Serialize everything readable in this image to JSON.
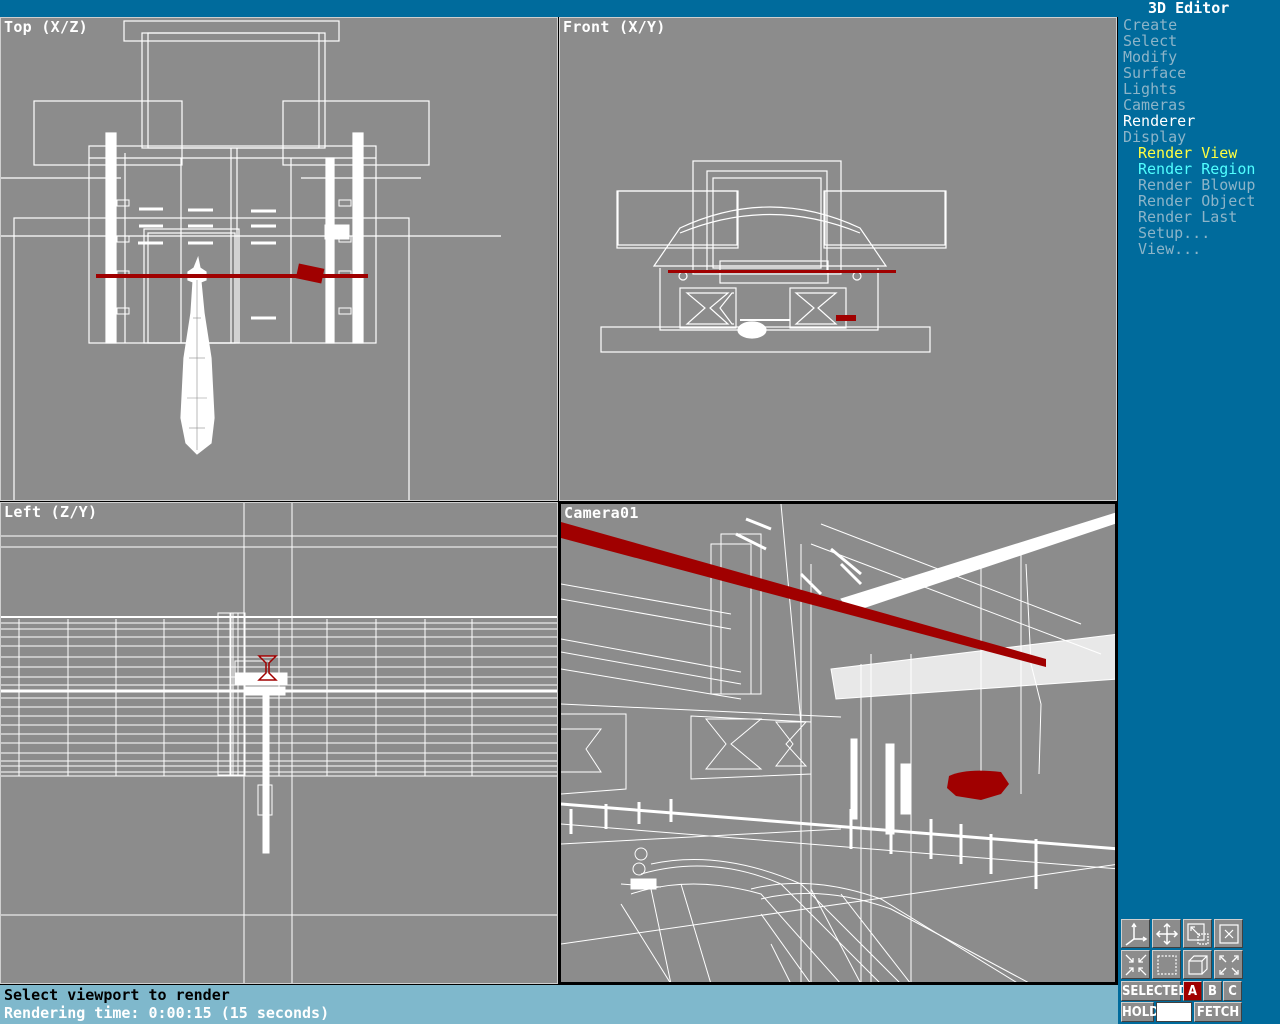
{
  "app": {
    "title": "3D Editor"
  },
  "menu": {
    "items": [
      {
        "label": "Create",
        "state": "normal"
      },
      {
        "label": "Select",
        "state": "normal"
      },
      {
        "label": "Modify",
        "state": "normal"
      },
      {
        "label": "Surface",
        "state": "normal"
      },
      {
        "label": "Lights",
        "state": "normal"
      },
      {
        "label": "Cameras",
        "state": "normal"
      },
      {
        "label": "Renderer",
        "state": "current"
      },
      {
        "label": "Display",
        "state": "normal"
      }
    ],
    "subitems": [
      {
        "label": "Render View",
        "state": "selected"
      },
      {
        "label": "Render Region",
        "state": "highlight"
      },
      {
        "label": "Render Blowup",
        "state": "normal"
      },
      {
        "label": "Render Object",
        "state": "normal"
      },
      {
        "label": "Render Last",
        "state": "normal"
      },
      {
        "label": "Setup...",
        "state": "normal"
      },
      {
        "label": "View...",
        "state": "normal"
      }
    ]
  },
  "viewports": {
    "top": {
      "title": "Top (X/Z)"
    },
    "front": {
      "title": "Front (X/Y)"
    },
    "left": {
      "title": "Left (Z/Y)"
    },
    "camera": {
      "title": "Camera01",
      "active": true
    }
  },
  "status": {
    "prompt": "Select viewport to render",
    "render_time": "Rendering time: 0:00:15 (15 seconds)"
  },
  "toolbar": {
    "icons": [
      {
        "name": "axis-tripod-icon"
      },
      {
        "name": "pan-move-icon"
      },
      {
        "name": "zoom-window-icon"
      },
      {
        "name": "zoom-extents-icon"
      },
      {
        "name": "zoom-in-icon"
      },
      {
        "name": "region-select-icon"
      },
      {
        "name": "user-view-cube-icon"
      },
      {
        "name": "zoom-out-icon"
      }
    ],
    "selected_label": "SELECTED",
    "sets": [
      "A",
      "B",
      "C"
    ],
    "active_set": "A",
    "hold_label": "HOLD",
    "fetch_label": "FETCH"
  },
  "colors": {
    "panel_bg": "#006b9c",
    "viewport_bg": "#8c8c8c",
    "wireframe": "#ffffff",
    "selected_object": "#a00000",
    "status_bg": "#7fb8cc",
    "menu_current": "#ffffff",
    "menu_selected": "#ffff40",
    "menu_highlight": "#50ffff",
    "menu_normal": "#8cb4c8"
  }
}
